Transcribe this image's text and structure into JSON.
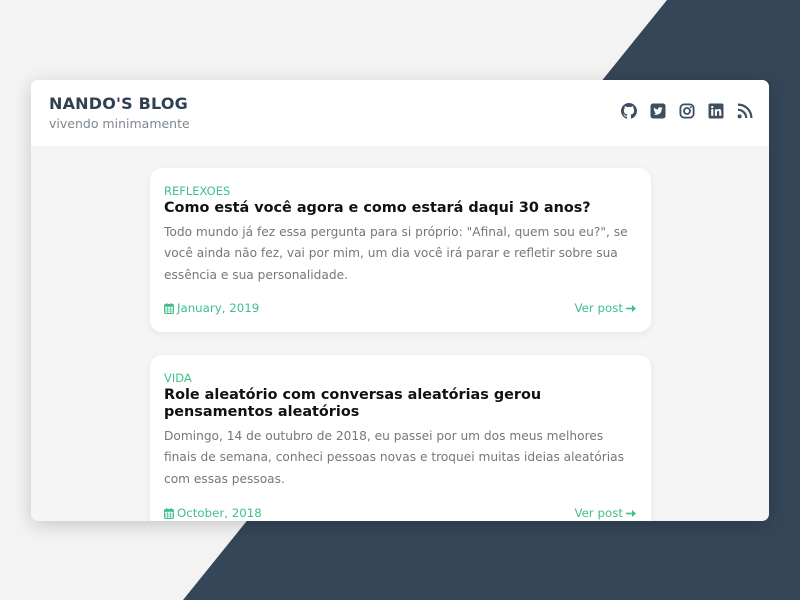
{
  "colors": {
    "page_background": "#f3f3f3",
    "dark_panel": "#354658",
    "accent_green": "#3fbf8a",
    "title_color": "#2f4051"
  },
  "header": {
    "title": "NANDO'S BLOG",
    "subtitle": "vivendo minimamente",
    "social_links": [
      {
        "icon": "github-icon"
      },
      {
        "icon": "twitter-icon"
      },
      {
        "icon": "instagram-icon"
      },
      {
        "icon": "linkedin-icon"
      },
      {
        "icon": "rss-icon"
      }
    ]
  },
  "posts": [
    {
      "category": "REFLEXOES",
      "title": "Como está você agora e como estará daqui 30 anos?",
      "excerpt": "Todo mundo já fez essa pergunta para si próprio: \"Afinal, quem sou eu?\", se você ainda não fez, vai por mim, um dia você irá parar e refletir sobre sua essência e sua personalidade.",
      "date": "January, 2019",
      "read_more": "Ver post"
    },
    {
      "category": "VIDA",
      "title": "Role aleatório com conversas aleatórias gerou pensamentos aleatórios",
      "excerpt": "Domingo, 14 de outubro de 2018, eu passei por um dos meus melhores finais de semana, conheci pessoas novas e troquei muitas ideias aleatórias com essas pessoas.",
      "date": "October, 2018",
      "read_more": "Ver post"
    }
  ]
}
